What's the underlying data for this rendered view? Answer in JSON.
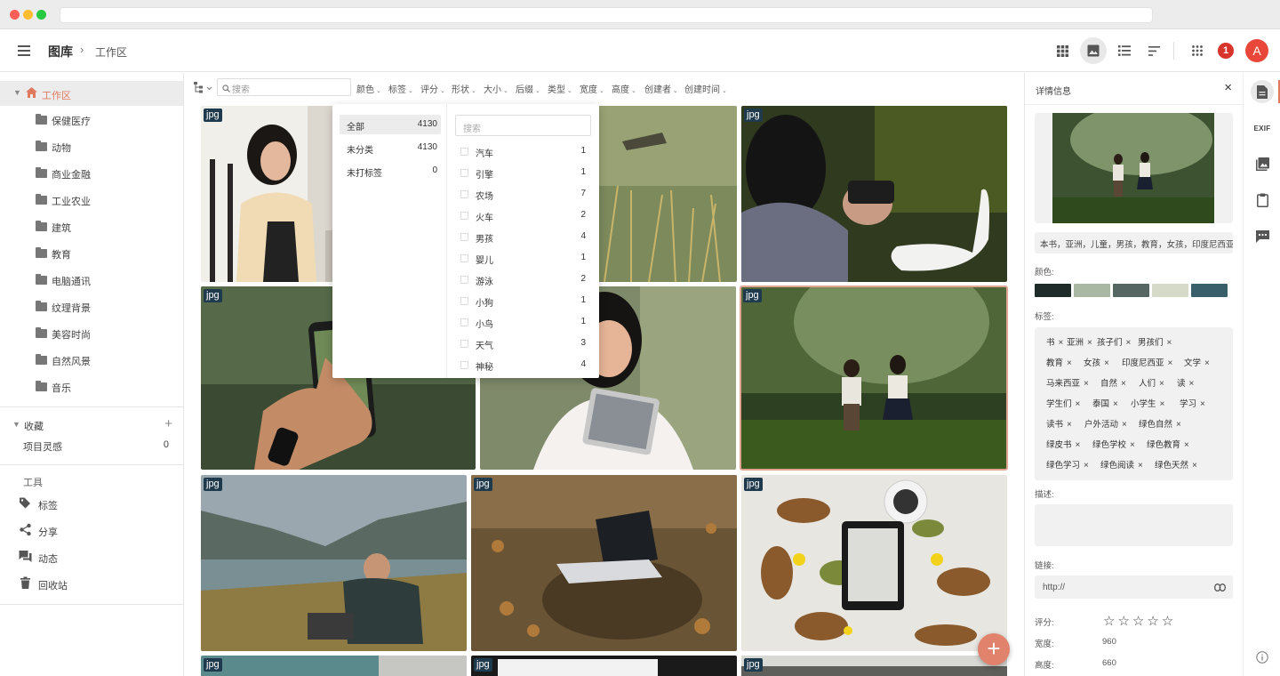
{
  "header": {
    "breadcrumb_root": "图库",
    "breadcrumb_sep": "›",
    "breadcrumb_current": "工作区",
    "notification_count": "1",
    "avatar_initial": "A"
  },
  "sidebar": {
    "root_label": "工作区",
    "folders": [
      "保健医疗",
      "动物",
      "商业金融",
      "工业农业",
      "建筑",
      "教育",
      "电脑通讯",
      "纹理背景",
      "美容时尚",
      "自然风景",
      "音乐"
    ],
    "favorites_label": "收藏",
    "favorites_add": "+",
    "favorites_items": [
      {
        "label": "项目灵感",
        "count": "0"
      }
    ],
    "tools_label": "工具",
    "tools": [
      "标签",
      "分享",
      "动态",
      "回收站"
    ]
  },
  "filterbar": {
    "search_placeholder": "搜索",
    "filters": [
      "颜色",
      "标签",
      "评分",
      "形状",
      "大小",
      "后缀",
      "类型",
      "宽度",
      "高度",
      "创建者",
      "创建时间"
    ]
  },
  "dropdown": {
    "left_options": [
      {
        "label": "全部",
        "count": "4130"
      },
      {
        "label": "未分类",
        "count": "4130"
      },
      {
        "label": "未打标签",
        "count": "0"
      }
    ],
    "search_placeholder": "搜索",
    "tags": [
      {
        "label": "汽车",
        "count": "1"
      },
      {
        "label": "引擎",
        "count": "1"
      },
      {
        "label": "农场",
        "count": "7"
      },
      {
        "label": "火车",
        "count": "2"
      },
      {
        "label": "男孩",
        "count": "4"
      },
      {
        "label": "婴儿",
        "count": "1"
      },
      {
        "label": "游泳",
        "count": "2"
      },
      {
        "label": "小狗",
        "count": "1"
      },
      {
        "label": "小鸟",
        "count": "1"
      },
      {
        "label": "天气",
        "count": "3"
      },
      {
        "label": "神秘",
        "count": "4"
      }
    ]
  },
  "grid": {
    "badge": "jpg",
    "add_button": "+"
  },
  "details": {
    "title": "详情信息",
    "close": "×",
    "keywords": "本书，亚洲，儿童，男孩，教育，女孩，印度尼西亚",
    "colors_label": "颜色:",
    "colors": [
      "#1e2b28",
      "#a9b8a2",
      "#566663",
      "#d6dac8",
      "#395f6b"
    ],
    "tags_label": "标签:",
    "tags": [
      "书",
      "亚洲",
      "孩子们",
      "男孩们",
      "教育",
      "女孩",
      "印度尼西亚",
      "文学",
      "马来西亚",
      "自然",
      "人们",
      "读",
      "学生们",
      "泰国",
      "小学生",
      "学习",
      "读书",
      "户外活动",
      "绿色自然",
      "绿皮书",
      "绿色学校",
      "绿色教育",
      "绿色学习",
      "绿色阅读",
      "绿色天然"
    ],
    "desc_label": "描述:",
    "link_label": "链接:",
    "link_placeholder": "http://",
    "rating_label": "评分:",
    "rating_stars": "☆☆☆☆☆",
    "width_label": "宽度:",
    "width_value": "960",
    "height_label": "高度:",
    "height_value": "660"
  },
  "rail": {
    "exif_label": "EXIF"
  }
}
